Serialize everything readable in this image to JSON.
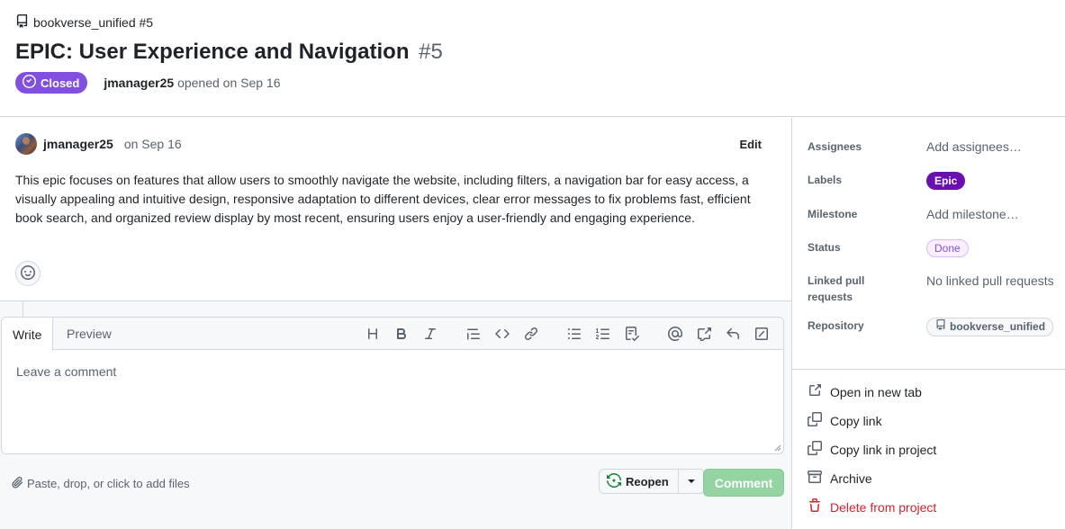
{
  "header": {
    "repo_name": "bookverse_unified #5",
    "title": "EPIC: User Experience and Navigation",
    "number": "#5",
    "state": "Closed",
    "author": "jmanager25",
    "opened_text": "opened on Sep 16"
  },
  "comment": {
    "author": "jmanager25",
    "date": "on Sep 16",
    "edit_label": "Edit",
    "body": "This epic focuses on features that allow users to smoothly navigate the website, including filters, a navigation bar for easy access, a visually appealing and intuitive design, responsive adaptation to different devices, clear error messages to fix problems fast, efficient book search, and organized review display by most recent, ensuring users enjoy a user-friendly and engaging experience."
  },
  "composer": {
    "tab_write": "Write",
    "tab_preview": "Preview",
    "placeholder": "Leave a comment",
    "attach_text": "Paste, drop, or click to add files",
    "reopen_label": "Reopen",
    "comment_label": "Comment",
    "toolbar_icons": [
      "heading-icon",
      "bold-icon",
      "italic-icon",
      "quote-icon",
      "code-icon",
      "link-icon",
      "unordered-list-icon",
      "ordered-list-icon",
      "task-list-icon",
      "mention-icon",
      "cross-reference-icon",
      "saved-reply-icon",
      "slash-command-icon"
    ]
  },
  "sidebar": {
    "assignees_label": "Assignees",
    "assignees_value": "Add assignees…",
    "labels_label": "Labels",
    "label_epic": "Epic",
    "milestone_label": "Milestone",
    "milestone_value": "Add milestone…",
    "status_label": "Status",
    "status_value": "Done",
    "linked_label_1": "Linked pull",
    "linked_label_2": "requests",
    "linked_value": "No linked pull requests",
    "repository_label": "Repository",
    "repository_value": "bookverse_unified",
    "actions": {
      "open_new_tab": "Open in new tab",
      "copy_link": "Copy link",
      "copy_link_project": "Copy link in project",
      "archive": "Archive",
      "delete": "Delete from project"
    }
  },
  "colors": {
    "closed_purple": "#8250df",
    "epic_label": "#6a0fb0",
    "danger": "#d1242f",
    "comment_button": "#94d3a2"
  }
}
